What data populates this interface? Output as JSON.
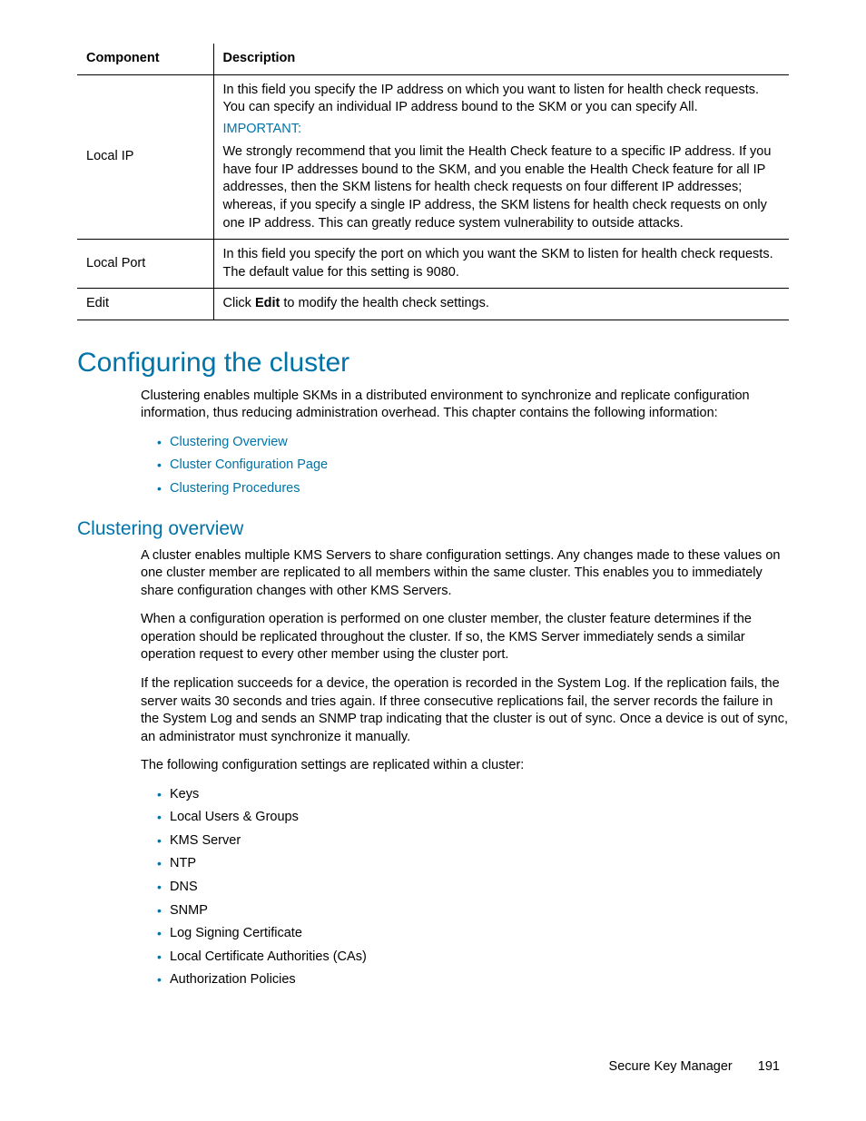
{
  "table": {
    "headers": {
      "col1": "Component",
      "col2": "Description"
    },
    "rows": [
      {
        "component": "Local IP",
        "desc_intro": "In this field you specify the IP address on which you want to listen for health check requests. You can specify an individual IP address bound to the SKM or you can specify All.",
        "important_label": "IMPORTANT:",
        "desc_important": "We strongly recommend that you limit the Health Check feature to a specific IP address. If you have four IP addresses bound to the SKM, and you enable the Health Check feature for all IP addresses, then the SKM listens for health check requests on four different IP addresses; whereas, if you specify a single IP address, the SKM listens for health check requests on only one IP address. This can greatly reduce system vulnerability to outside attacks."
      },
      {
        "component": "Local Port",
        "desc": "In this field you specify the port on which you want the SKM to listen for health check requests. The default value for this setting is 9080."
      },
      {
        "component": "Edit",
        "desc_prefix": "Click ",
        "desc_bold": "Edit",
        "desc_suffix": " to modify the health check settings."
      }
    ]
  },
  "section_heading": "Configuring the cluster",
  "section_intro": "Clustering enables multiple SKMs in a distributed environment to synchronize and replicate configuration information, thus reducing administration overhead. This chapter contains the following information:",
  "links": [
    "Clustering Overview",
    "Cluster Configuration Page",
    "Clustering Procedures"
  ],
  "subsection_heading": "Clustering overview",
  "paragraphs": [
    "A cluster enables multiple KMS Servers to share configuration settings. Any changes made to these values on one cluster member are replicated to all members within the same cluster. This enables you to immediately share configuration changes with other KMS Servers.",
    "When a configuration operation is performed on one cluster member, the cluster feature determines if the operation should be replicated throughout the cluster. If so, the KMS Server immediately sends a similar operation request to every other member using the cluster port.",
    "If the replication succeeds for a device, the operation is recorded in the System Log. If the replication fails, the server waits 30 seconds and tries again. If three consecutive replications fail, the server records the failure in the System Log and sends an SNMP trap indicating that the cluster is out of sync. Once a device is out of sync, an administrator must synchronize it manually.",
    "The following configuration settings are replicated within a cluster:"
  ],
  "replicated_items": [
    "Keys",
    "Local Users & Groups",
    "KMS Server",
    "NTP",
    "DNS",
    "SNMP",
    "Log Signing Certificate",
    "Local Certificate Authorities (CAs)",
    "Authorization Policies"
  ],
  "footer": {
    "doc_title": "Secure Key Manager",
    "page_number": "191"
  }
}
